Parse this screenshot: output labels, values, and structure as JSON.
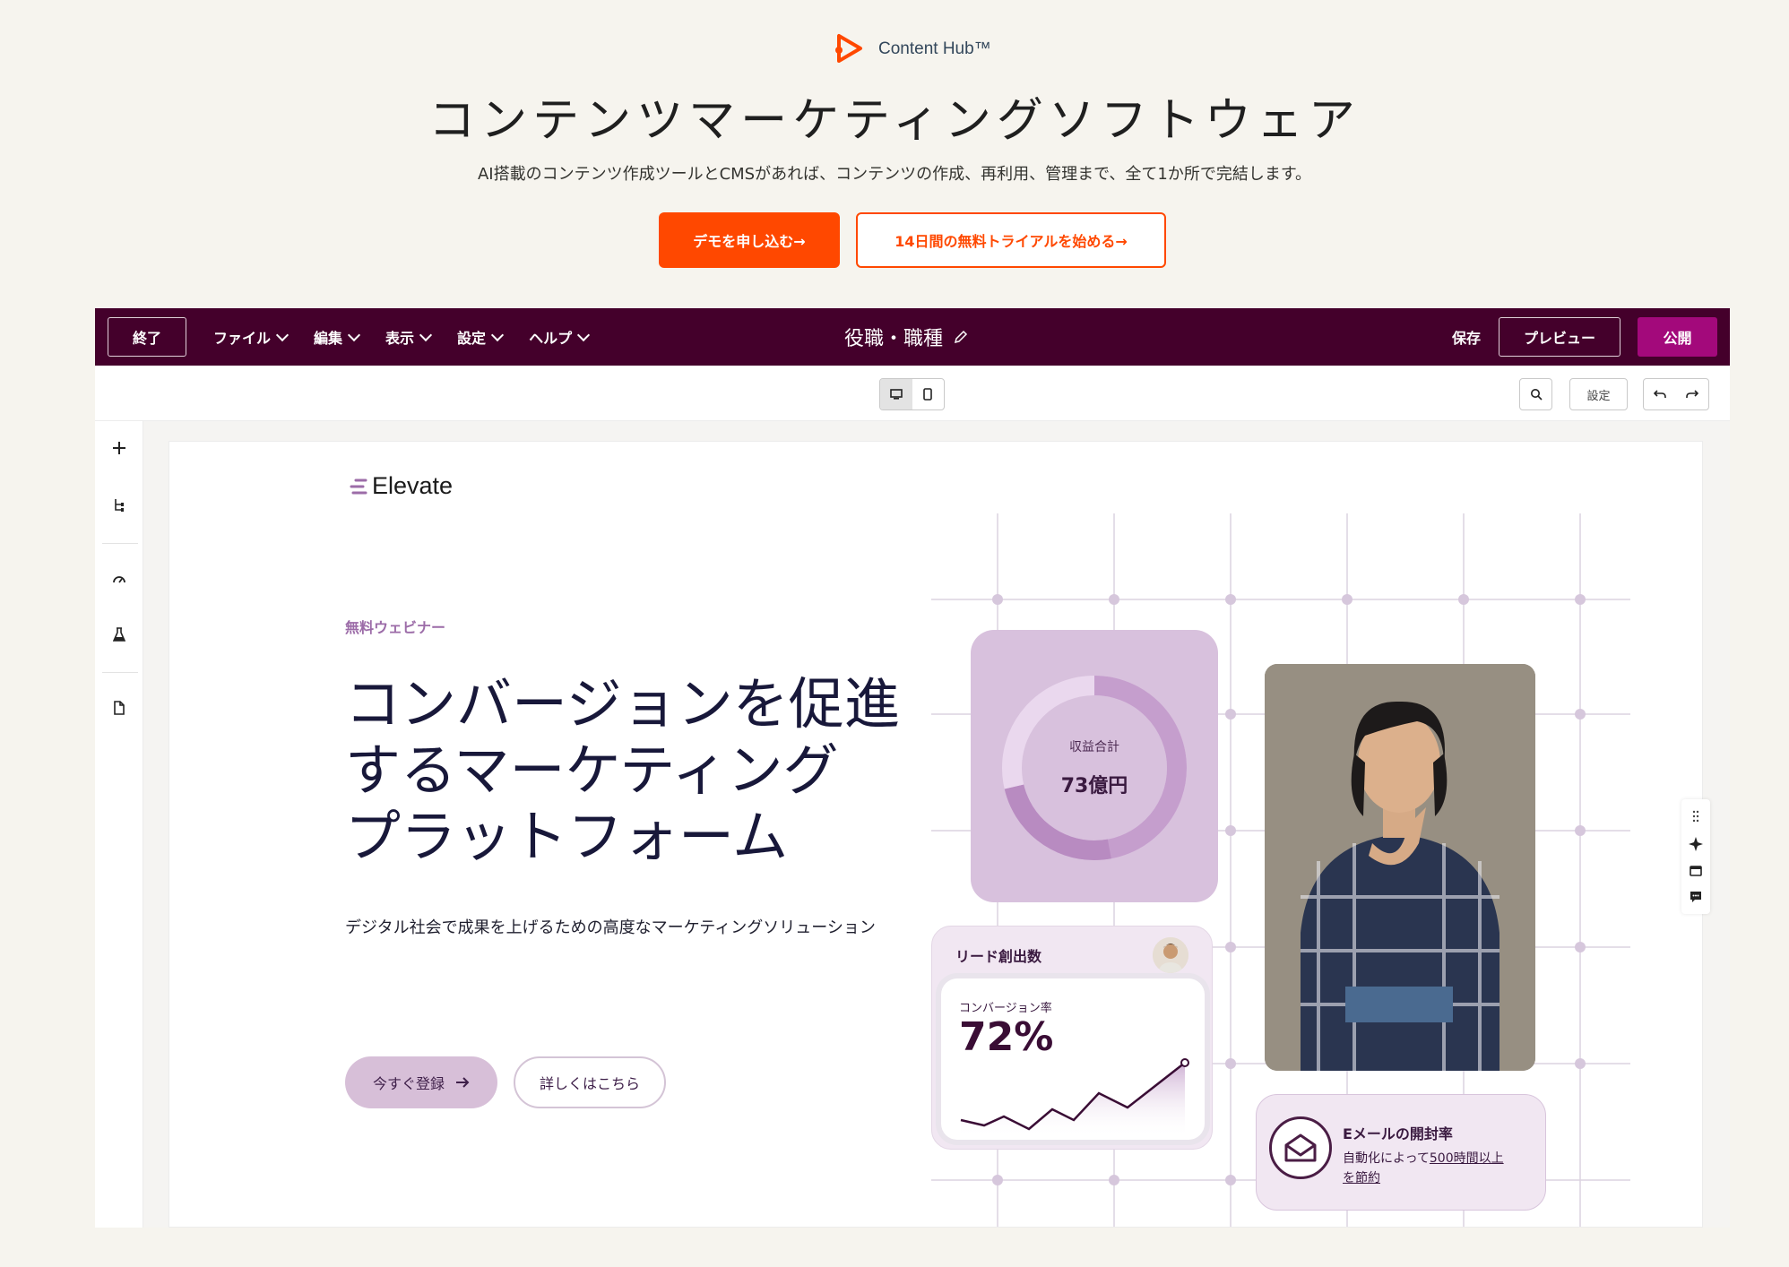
{
  "hero": {
    "brand_name": "Content Hub™",
    "title": "コンテンツマーケティングソフトウェア",
    "subtitle": "AI搭載のコンテンツ作成ツールとCMSがあれば、コンテンツの作成、再利用、管理まで、全て1か所で完結します。",
    "demo_button": "デモを申し込む→",
    "trial_button": "14日間の無料トライアルを始める→"
  },
  "editor": {
    "exit_label": "終了",
    "menu": [
      "ファイル",
      "編集",
      "表示",
      "設定",
      "ヘルプ"
    ],
    "page_title": "役職・職種",
    "save_label": "保存",
    "preview_label": "プレビュー",
    "publish_label": "公開",
    "settings_label": "設定"
  },
  "page": {
    "brand": "Elevate",
    "eyebrow": "無料ウェビナー",
    "headline_lines": [
      "コンバージョンを促進",
      "するマーケティング",
      "プラットフォーム"
    ],
    "description": "デジタル社会で成果を上げるための高度なマーケティングソリューション",
    "cta_primary": "今すぐ登録",
    "cta_secondary": "詳しくはこちら",
    "revenue_card": {
      "label": "収益合計",
      "value": "73億円"
    },
    "lead_card": {
      "title": "リード創出数",
      "conversion_label": "コンバージョン率",
      "conversion_value": "72%"
    },
    "email_card": {
      "title": "Eメールの開封率",
      "text_prefix": "自動化によって",
      "text_link1": "500時間以上",
      "text_link2": "を節約"
    }
  },
  "colors": {
    "accent_orange": "#ff4800",
    "editor_bar": "#44002b",
    "publish": "#a3097b",
    "card_purple": "#d8c1dd"
  }
}
